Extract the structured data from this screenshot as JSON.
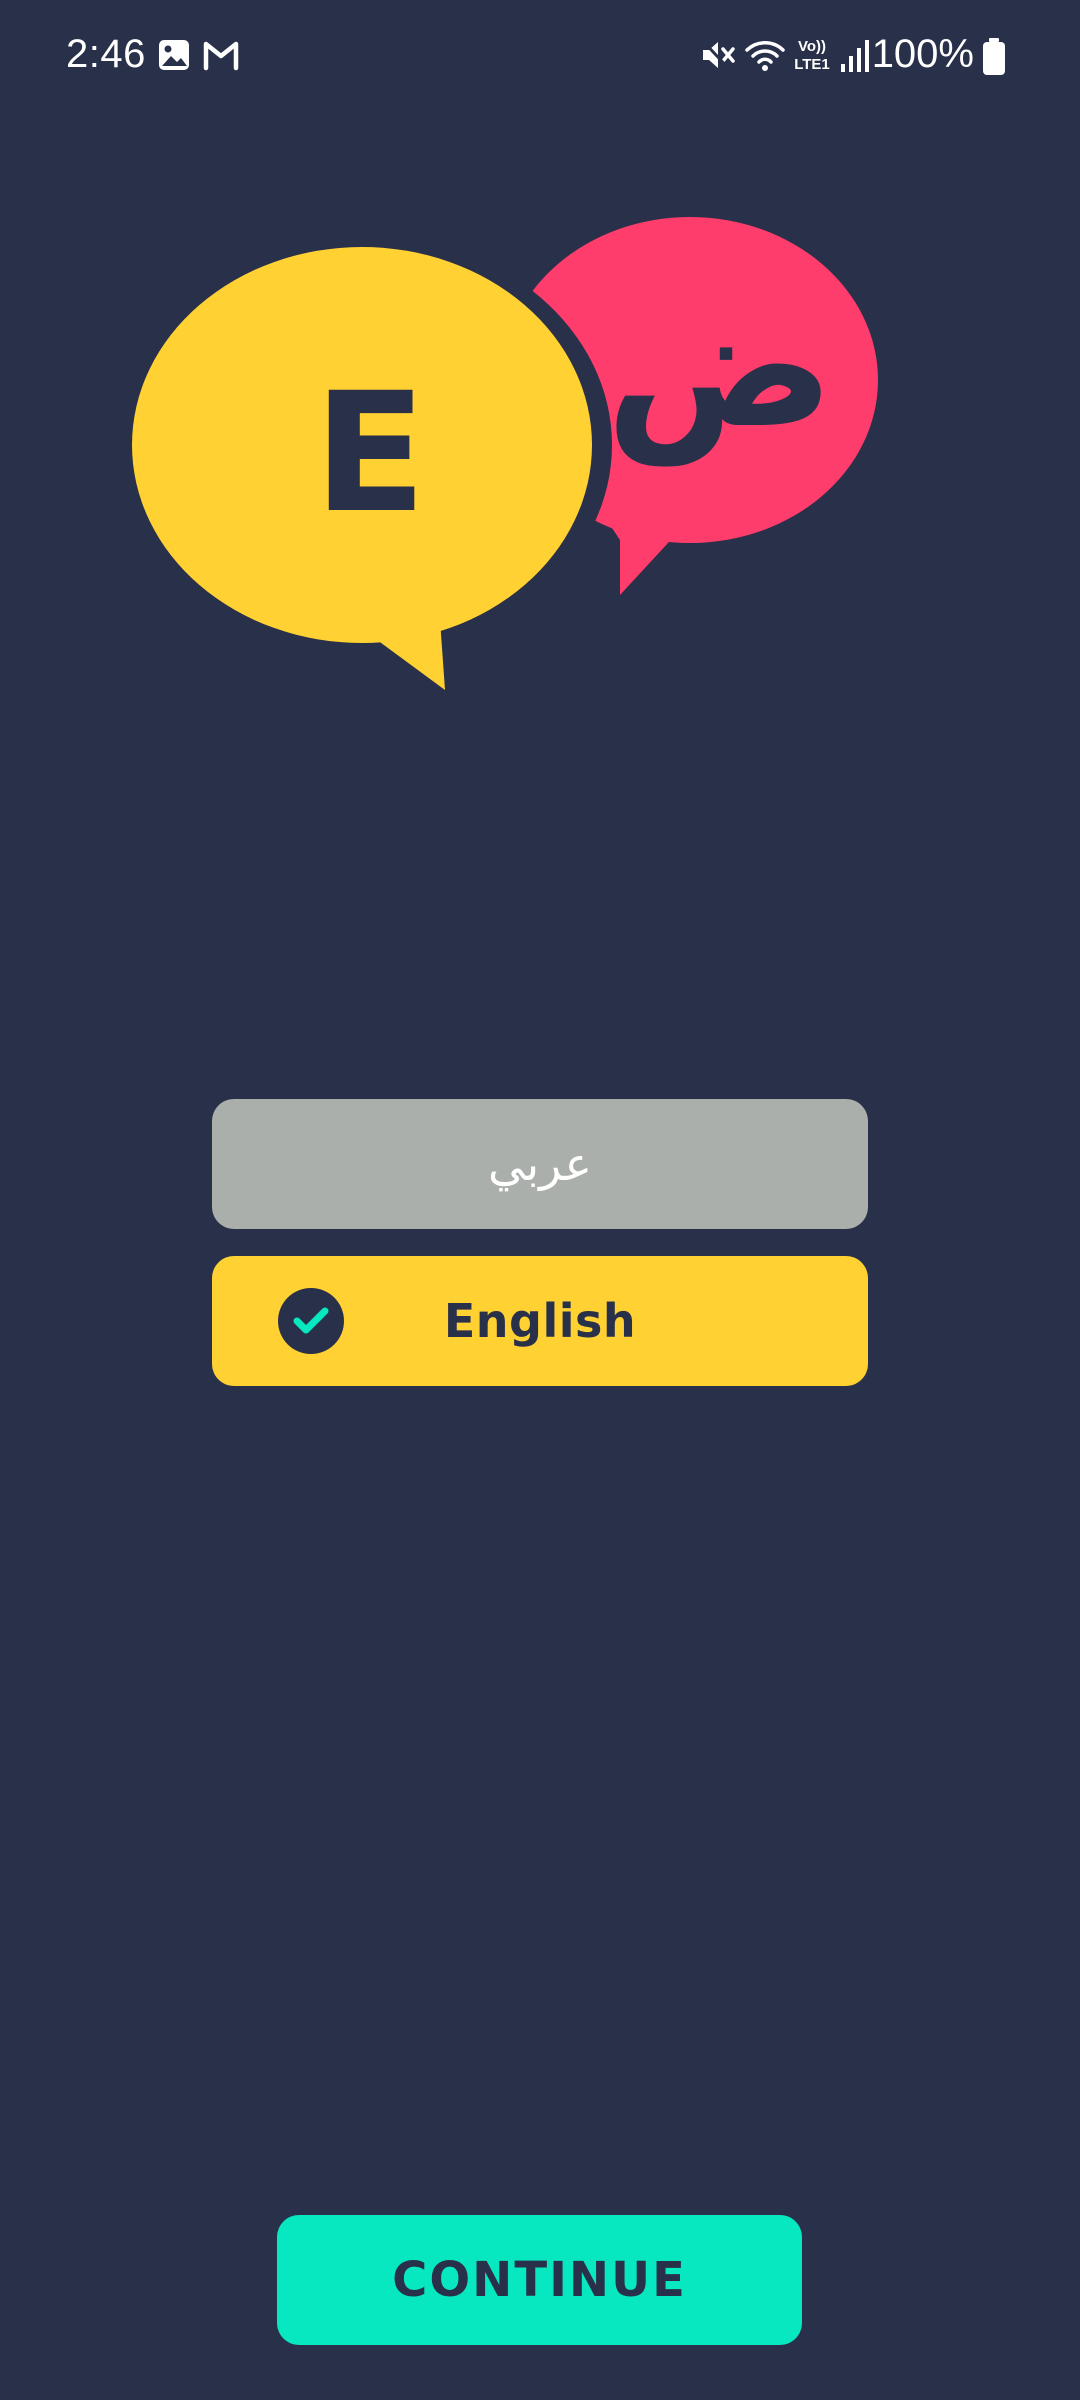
{
  "status_bar": {
    "time": "2:46",
    "network_label": "Vo))\nLTE1",
    "battery_percent": "100%",
    "icons": [
      "gallery-icon",
      "gmail-icon",
      "mute-icon",
      "wifi-icon",
      "signal-icon",
      "battery-icon"
    ]
  },
  "logo": {
    "left_bubble_letter": "E",
    "right_bubble_letter": "ض",
    "left_bubble_color": "#ffd133",
    "right_bubble_color": "#ff3d6c"
  },
  "languages": {
    "arabic": {
      "label": "عربي",
      "selected": false
    },
    "english": {
      "label": "English",
      "selected": true
    }
  },
  "continue": {
    "label": "CONTINUE"
  },
  "colors": {
    "background": "#293049",
    "accent": "#07e8c0",
    "selected": "#ffd133",
    "unselected": "#abafab"
  }
}
